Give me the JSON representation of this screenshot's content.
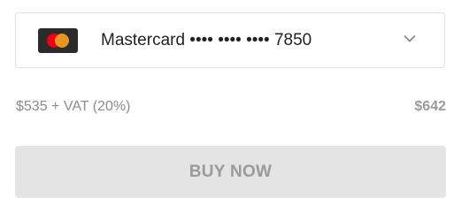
{
  "payment_method": {
    "brand_icon": "mastercard-icon",
    "label": "Mastercard •••• •••• •••• 7850",
    "dropdown_icon": "chevron-down-icon"
  },
  "pricing": {
    "breakdown": "$535 + VAT (20%)",
    "total": "$642"
  },
  "actions": {
    "buy_now_label": "BUY NOW",
    "buy_now_state": "disabled"
  },
  "colors": {
    "mastercard_red": "#eb001b",
    "mastercard_orange": "#f79e1b",
    "button_disabled_bg": "#e4e4e4"
  }
}
